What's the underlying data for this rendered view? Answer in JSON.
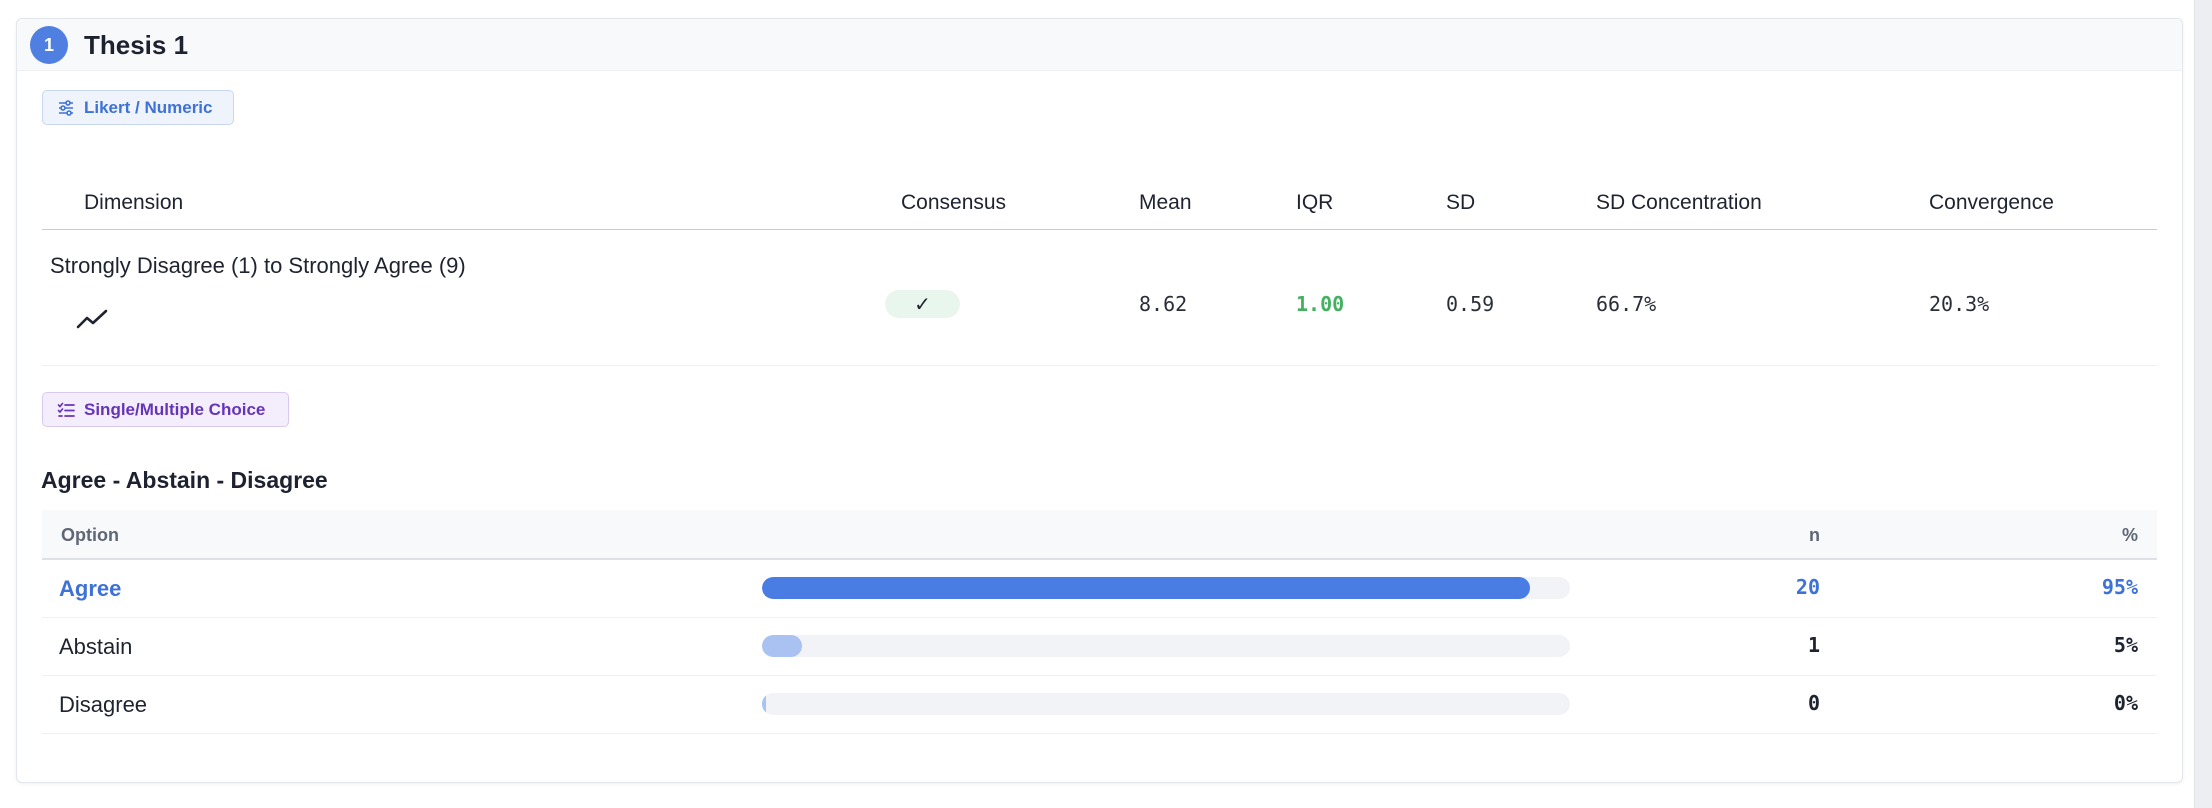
{
  "thesis": {
    "number": "1",
    "title": "Thesis 1"
  },
  "likert": {
    "type_label": "Likert / Numeric",
    "headers": {
      "dimension": "Dimension",
      "consensus": "Consensus",
      "mean": "Mean",
      "iqr": "IQR",
      "sd": "SD",
      "sd_concentration": "SD Concentration",
      "convergence": "Convergence"
    },
    "row": {
      "dimension": "Strongly Disagree (1) to Strongly Agree (9)",
      "trend_icon": "trending-up-icon",
      "consensus": "✓",
      "mean": "8.62",
      "iqr": "1.00",
      "sd": "0.59",
      "sd_concentration": "66.7%",
      "convergence": "20.3%"
    }
  },
  "choice": {
    "type_label": "Single/Multiple Choice",
    "question": "Agree - Abstain - Disagree",
    "headers": {
      "option": "Option",
      "n": "n",
      "pct": "%"
    },
    "options": [
      {
        "label": "Agree",
        "n": "20",
        "pct": "95%",
        "share": 0.95,
        "selected": true,
        "bar_color": "#4a7de3"
      },
      {
        "label": "Abstain",
        "n": "1",
        "pct": "5%",
        "share": 0.05,
        "selected": false,
        "bar_color": "#a9c2f1"
      },
      {
        "label": "Disagree",
        "n": "0",
        "pct": "0%",
        "share": 0.0,
        "selected": false,
        "bar_color": "#a9c2f1"
      }
    ]
  },
  "colors": {
    "accent": "#4f7fe0",
    "success": "#45b062",
    "choice_purple": "#6535b6"
  }
}
